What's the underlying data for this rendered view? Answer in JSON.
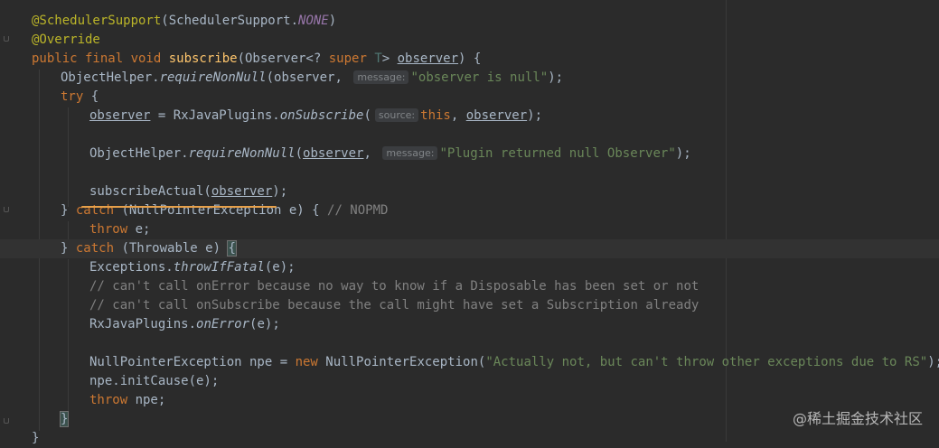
{
  "editor": {
    "lines": [
      {
        "id": "l1",
        "indent": 0,
        "tokens": [
          {
            "c": "ann",
            "t": "@SchedulerSupport"
          },
          {
            "c": "",
            "t": "(SchedulerSupport."
          },
          {
            "c": "const",
            "t": "NONE"
          },
          {
            "c": "",
            "t": ")"
          }
        ]
      },
      {
        "id": "l2",
        "indent": 0,
        "tokens": [
          {
            "c": "ann",
            "t": "@Override"
          }
        ]
      },
      {
        "id": "l3",
        "indent": 0,
        "tokens": [
          {
            "c": "kw",
            "t": "public final void "
          },
          {
            "c": "fn",
            "t": "subscribe"
          },
          {
            "c": "",
            "t": "(Observer<? "
          },
          {
            "c": "kw",
            "t": "super "
          },
          {
            "c": "tp",
            "t": "T"
          },
          {
            "c": "",
            "t": "> "
          },
          {
            "c": "ul",
            "t": "observer"
          },
          {
            "c": "",
            "t": ") {"
          }
        ]
      },
      {
        "id": "l4",
        "indent": 1,
        "tokens": [
          {
            "c": "",
            "t": "ObjectHelper."
          },
          {
            "c": "it",
            "t": "requireNonNull"
          },
          {
            "c": "",
            "t": "(observer, "
          },
          {
            "c": "hint",
            "t": "message:"
          },
          {
            "c": "str",
            "t": "\"observer is null\""
          },
          {
            "c": "",
            "t": ");"
          }
        ]
      },
      {
        "id": "l5",
        "indent": 1,
        "tokens": [
          {
            "c": "kw",
            "t": "try "
          },
          {
            "c": "",
            "t": "{"
          }
        ]
      },
      {
        "id": "l6",
        "indent": 2,
        "tokens": [
          {
            "c": "ul",
            "t": "observer"
          },
          {
            "c": "",
            "t": " = RxJavaPlugins."
          },
          {
            "c": "it",
            "t": "onSubscribe"
          },
          {
            "c": "",
            "t": "("
          },
          {
            "c": "hint",
            "t": "source:"
          },
          {
            "c": "kw",
            "t": "this"
          },
          {
            "c": "",
            "t": ", "
          },
          {
            "c": "ul",
            "t": "observer"
          },
          {
            "c": "",
            "t": ");"
          }
        ]
      },
      {
        "id": "l7",
        "indent": 0,
        "tokens": []
      },
      {
        "id": "l8",
        "indent": 2,
        "tokens": [
          {
            "c": "",
            "t": "ObjectHelper."
          },
          {
            "c": "it",
            "t": "requireNonNull"
          },
          {
            "c": "",
            "t": "("
          },
          {
            "c": "ul",
            "t": "observer"
          },
          {
            "c": "",
            "t": ", "
          },
          {
            "c": "hint",
            "t": "message:"
          },
          {
            "c": "str",
            "t": "\"Plugin returned null Observer\""
          },
          {
            "c": "",
            "t": ");"
          }
        ]
      },
      {
        "id": "l9",
        "indent": 0,
        "tokens": []
      },
      {
        "id": "l10",
        "indent": 2,
        "tokens": [
          {
            "c": "",
            "t": "subscribeActual("
          },
          {
            "c": "ul",
            "t": "observer"
          },
          {
            "c": "",
            "t": ");"
          }
        ]
      },
      {
        "id": "l11",
        "indent": 1,
        "tokens": [
          {
            "c": "",
            "t": "} "
          },
          {
            "c": "kw",
            "t": "catch "
          },
          {
            "c": "",
            "t": "(NullPointerException e) { "
          },
          {
            "c": "cmt",
            "t": "// NOPMD"
          }
        ]
      },
      {
        "id": "l12",
        "indent": 2,
        "tokens": [
          {
            "c": "kw",
            "t": "throw "
          },
          {
            "c": "",
            "t": "e;"
          }
        ]
      },
      {
        "id": "l13",
        "indent": 1,
        "current": true,
        "tokens": [
          {
            "c": "",
            "t": "} "
          },
          {
            "c": "kw",
            "t": "catch "
          },
          {
            "c": "",
            "t": "(Throwable e) "
          },
          {
            "c": "brace-hl",
            "t": "{"
          }
        ]
      },
      {
        "id": "l14",
        "indent": 2,
        "tokens": [
          {
            "c": "",
            "t": "Exceptions."
          },
          {
            "c": "it",
            "t": "throwIfFatal"
          },
          {
            "c": "",
            "t": "(e);"
          }
        ]
      },
      {
        "id": "l15",
        "indent": 2,
        "tokens": [
          {
            "c": "cmt",
            "t": "// can't call onError because no way to know if a Disposable has been set or not"
          }
        ]
      },
      {
        "id": "l16",
        "indent": 2,
        "tokens": [
          {
            "c": "cmt",
            "t": "// can't call onSubscribe because the call might have set a Subscription already"
          }
        ]
      },
      {
        "id": "l17",
        "indent": 2,
        "tokens": [
          {
            "c": "",
            "t": "RxJavaPlugins."
          },
          {
            "c": "it",
            "t": "onError"
          },
          {
            "c": "",
            "t": "(e);"
          }
        ]
      },
      {
        "id": "l18",
        "indent": 0,
        "tokens": []
      },
      {
        "id": "l19",
        "indent": 2,
        "tokens": [
          {
            "c": "",
            "t": "NullPointerException npe = "
          },
          {
            "c": "kw",
            "t": "new "
          },
          {
            "c": "",
            "t": "NullPointerException("
          },
          {
            "c": "str",
            "t": "\"Actually not, but can't throw other exceptions due to RS\""
          },
          {
            "c": "",
            "t": ");"
          }
        ]
      },
      {
        "id": "l20",
        "indent": 2,
        "tokens": [
          {
            "c": "",
            "t": "npe.initCause(e);"
          }
        ]
      },
      {
        "id": "l21",
        "indent": 2,
        "tokens": [
          {
            "c": "kw",
            "t": "throw "
          },
          {
            "c": "",
            "t": "npe;"
          }
        ]
      },
      {
        "id": "l22",
        "indent": 1,
        "tokens": [
          {
            "c": "brace-hl",
            "t": "}"
          }
        ]
      },
      {
        "id": "l23",
        "indent": 0,
        "tokens": [
          {
            "c": "",
            "t": "}"
          }
        ]
      }
    ]
  },
  "watermark": {
    "text": "@稀土掘金技术社区"
  }
}
